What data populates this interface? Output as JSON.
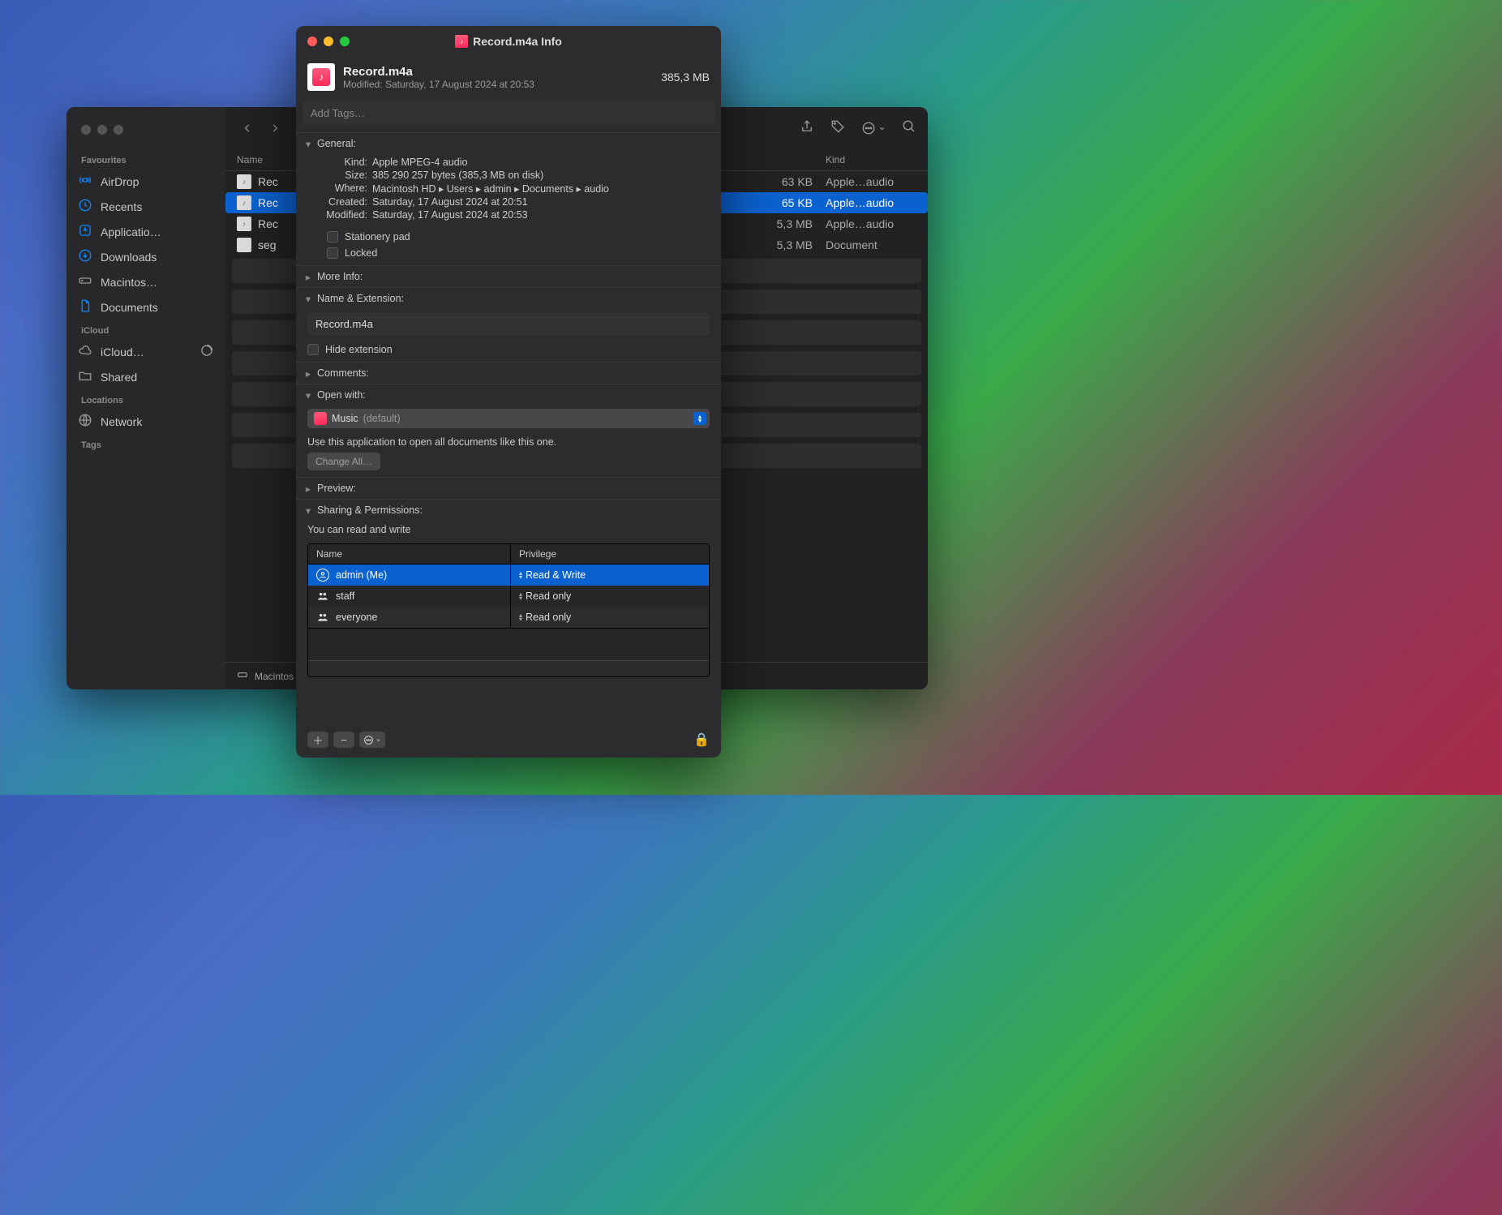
{
  "finder": {
    "sidebar": {
      "favourites_label": "Favourites",
      "items": [
        {
          "label": "AirDrop"
        },
        {
          "label": "Recents"
        },
        {
          "label": "Applicatio…"
        },
        {
          "label": "Downloads"
        },
        {
          "label": "Macintos…"
        },
        {
          "label": "Documents"
        }
      ],
      "icloud_label": "iCloud",
      "icloud_items": [
        {
          "label": "iCloud…"
        },
        {
          "label": "Shared"
        }
      ],
      "locations_label": "Locations",
      "network_label": "Network",
      "tags_label": "Tags"
    },
    "columns": {
      "name": "Name",
      "kind": "Kind"
    },
    "rows": [
      {
        "name": "Rec",
        "size": "63 KB",
        "kind": "Apple…audio"
      },
      {
        "name": "Rec",
        "size": "65 KB",
        "kind": "Apple…audio"
      },
      {
        "name": "Rec",
        "size": "5,3 MB",
        "kind": "Apple…audio"
      },
      {
        "name": "seg",
        "size": "5,3 MB",
        "kind": "Document"
      }
    ],
    "pathbar": "Macintos"
  },
  "info": {
    "window_title": "Record.m4a Info",
    "filename": "Record.m4a",
    "filesize": "385,3 MB",
    "modified_line": "Modified: Saturday, 17 August 2024 at 20:53",
    "tags_placeholder": "Add Tags…",
    "sections": {
      "general": "General:",
      "more_info": "More Info:",
      "name_ext": "Name & Extension:",
      "comments": "Comments:",
      "open_with": "Open with:",
      "preview": "Preview:",
      "sharing": "Sharing & Permissions:"
    },
    "general": {
      "kind_k": "Kind:",
      "kind_v": "Apple MPEG-4 audio",
      "size_k": "Size:",
      "size_v": "385 290 257 bytes (385,3 MB on disk)",
      "where_k": "Where:",
      "where_v": "Macintosh HD ▸ Users ▸ admin ▸ Documents ▸ audio",
      "created_k": "Created:",
      "created_v": "Saturday, 17 August 2024 at 20:51",
      "modified_k": "Modified:",
      "modified_v": "Saturday, 17 August 2024 at 20:53",
      "stationery": "Stationery pad",
      "locked": "Locked"
    },
    "name_ext_value": "Record.m4a",
    "hide_ext": "Hide extension",
    "open_with": {
      "app": "Music",
      "default": "(default)",
      "desc": "Use this application to open all documents like this one.",
      "change_all": "Change All…"
    },
    "permissions": {
      "desc": "You can read and write",
      "col_name": "Name",
      "col_priv": "Privilege",
      "rows": [
        {
          "name": "admin (Me)",
          "priv": "Read & Write",
          "type": "user"
        },
        {
          "name": "staff",
          "priv": "Read only",
          "type": "group"
        },
        {
          "name": "everyone",
          "priv": "Read only",
          "type": "group"
        }
      ]
    }
  }
}
